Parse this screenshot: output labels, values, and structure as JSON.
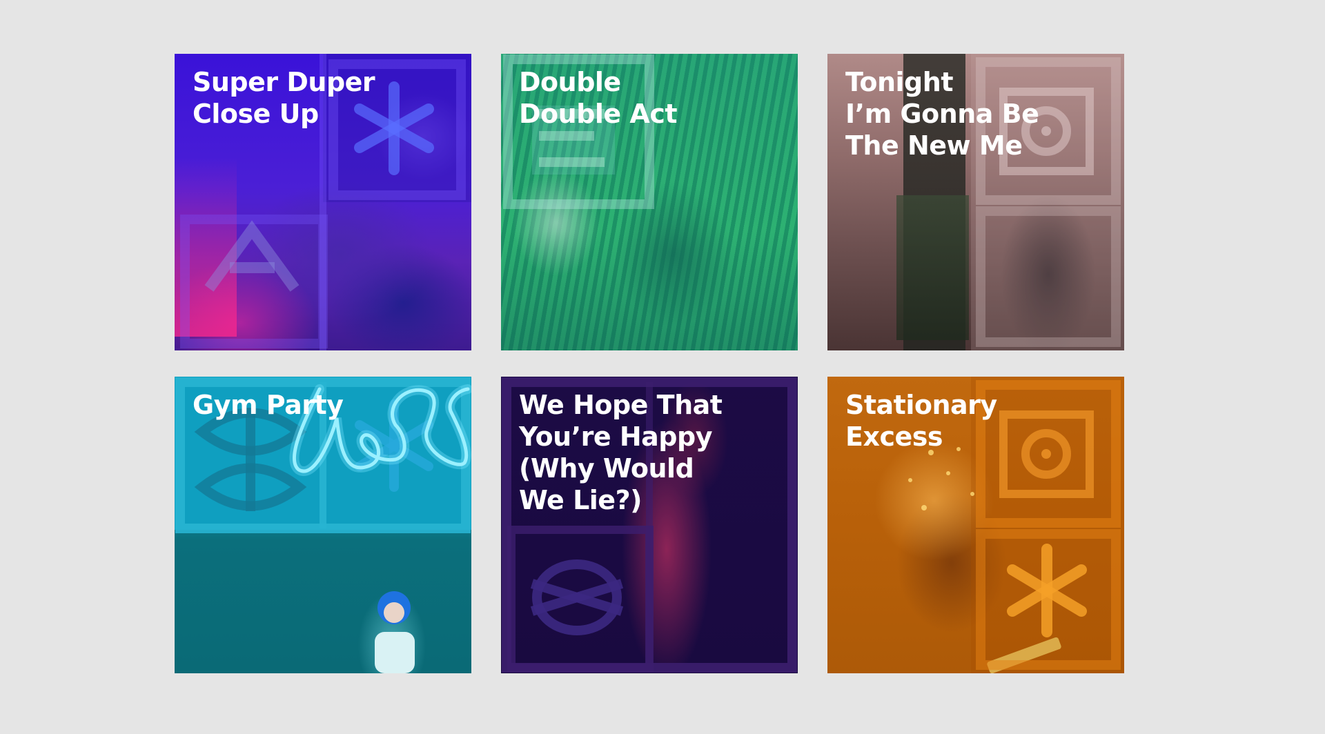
{
  "tiles": [
    {
      "title": "Super Duper\nClose Up",
      "color": "#3a12d8"
    },
    {
      "title": "Double\nDouble Act",
      "color": "#2bb47a"
    },
    {
      "title": "Tonight\nI’m Gonna Be\nThe New Me",
      "color": "#8f6b6a"
    },
    {
      "title": "Gym Party",
      "color": "#0f9fc0"
    },
    {
      "title": "We Hope That\nYou’re Happy\n(Why Would\nWe Lie?)",
      "color": "#1c0b45"
    },
    {
      "title": "Stationary\nExcess",
      "color": "#c1690f"
    }
  ]
}
